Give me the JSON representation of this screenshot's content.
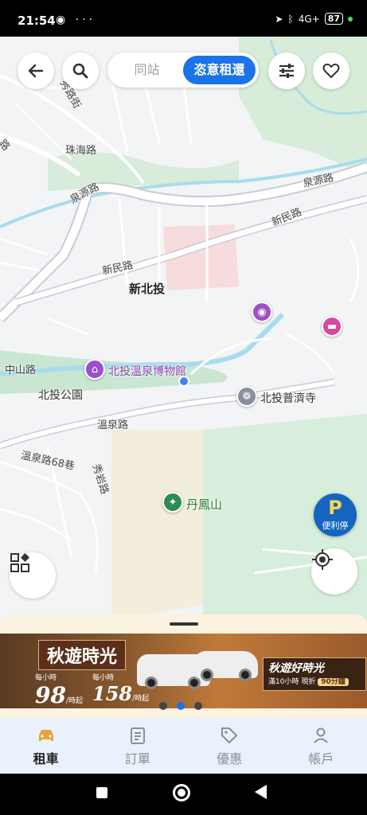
{
  "status_bar": {
    "time": "21:54",
    "left_icons": "◉ ···",
    "network": "4G+",
    "battery": "87"
  },
  "top_bar": {
    "segment_options": [
      "同站",
      "恣意租還"
    ],
    "active_segment": "恣意租還"
  },
  "map": {
    "place_labels": {
      "xinbeitou": "新北投",
      "museum": "北投溫泉博物館",
      "beitou_park": "北投公園",
      "puji_temple": "北投普濟寺",
      "danfeng_mountain": "丹鳳山"
    },
    "road_labels": {
      "quanyuan_1": "泉源路",
      "quanyuan_2": "泉源路",
      "xinmin_1": "新民路",
      "xinmin_2": "新民路",
      "zhuhai": "珠海路",
      "zhongshan": "中山路",
      "wenquan": "溫泉路",
      "wenquan68": "溫泉路68巷",
      "xiuyan": "秀岩路",
      "partial_top": "秀路街",
      "partial_left": "路"
    },
    "parking_button": {
      "letter": "P",
      "label": "便利停"
    }
  },
  "banner": {
    "title": "秋遊時光",
    "price1": "98",
    "price2": "158",
    "price_tag1": "每小時",
    "price_tag2": "每小時",
    "price_unit": "/時起",
    "right_title": "秋遊好時光",
    "right_sub": "滿10小時 現折",
    "right_badge": "90分鐘",
    "page_count": 3,
    "active_page": 2
  },
  "tabs": [
    {
      "label": "租車",
      "icon": "car-icon",
      "active": true
    },
    {
      "label": "訂單",
      "icon": "order-icon",
      "active": false
    },
    {
      "label": "優惠",
      "icon": "tag-icon",
      "active": false
    },
    {
      "label": "帳戶",
      "icon": "user-icon",
      "active": false
    }
  ],
  "colors": {
    "accent": "#1a73e8",
    "active_tab_icon": "#e6a23c",
    "parking": "#1565c0"
  }
}
